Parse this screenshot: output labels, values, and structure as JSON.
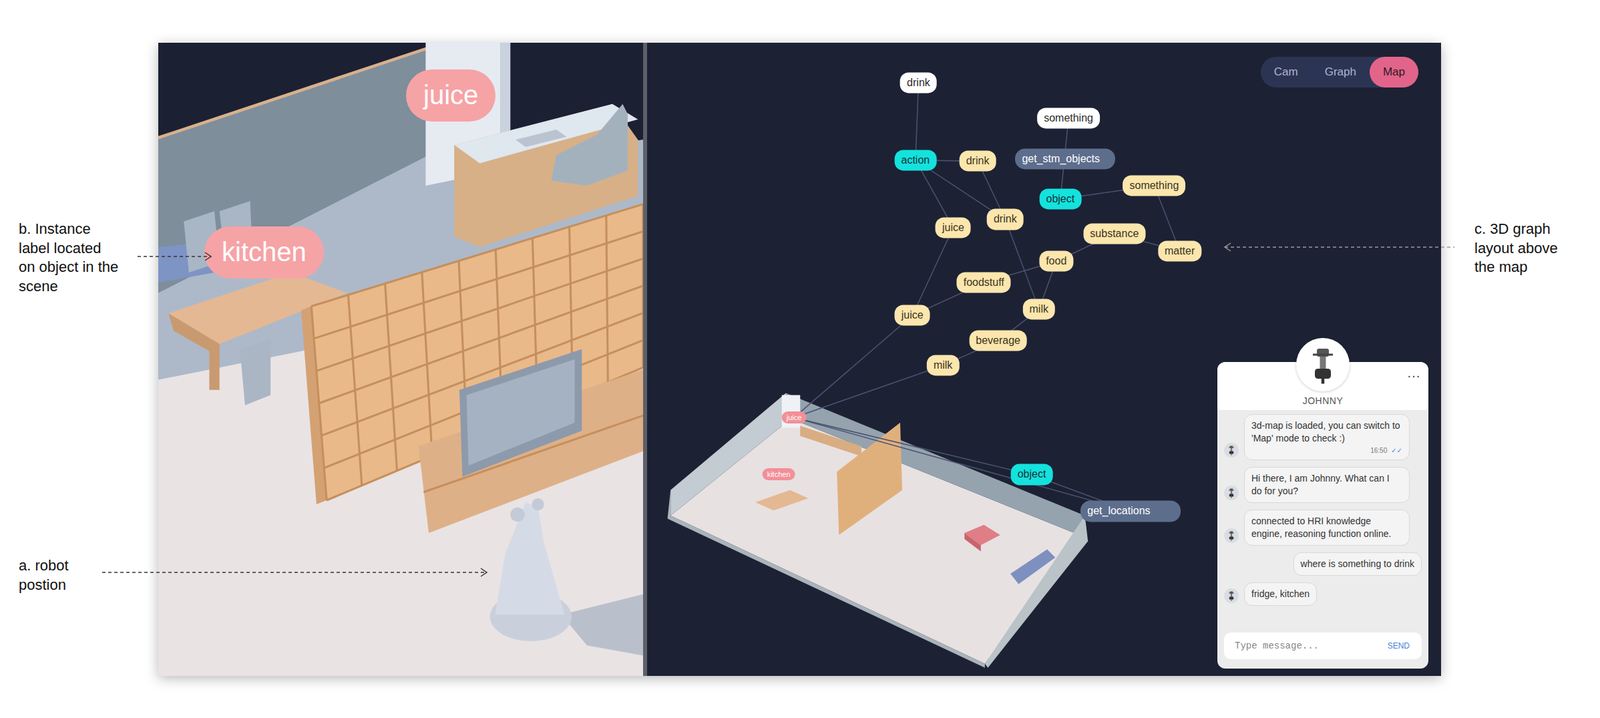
{
  "annotations": [
    {
      "text": "b. Instance label located on object in the scene"
    },
    {
      "text": "a. robot postion"
    },
    {
      "text": "c. 3D graph layout above the map"
    }
  ],
  "scene": {
    "labels": [
      {
        "text": "kitchen"
      },
      {
        "text": "juice"
      }
    ]
  },
  "view_tabs": [
    {
      "label": "Cam",
      "selected": false
    },
    {
      "label": "Graph",
      "selected": false
    },
    {
      "label": "Map",
      "selected": true
    }
  ],
  "graph": {
    "nodes": [
      {
        "label": "drink",
        "kind": "query"
      },
      {
        "label": "something",
        "kind": "query"
      },
      {
        "label": "action",
        "kind": "category"
      },
      {
        "label": "drink",
        "kind": "concept"
      },
      {
        "label": "get_stm_objects",
        "kind": "function"
      },
      {
        "label": "object",
        "kind": "category"
      },
      {
        "label": "something",
        "kind": "concept"
      },
      {
        "label": "juice",
        "kind": "concept"
      },
      {
        "label": "drink",
        "kind": "concept"
      },
      {
        "label": "substance",
        "kind": "concept"
      },
      {
        "label": "matter",
        "kind": "concept"
      },
      {
        "label": "food",
        "kind": "concept"
      },
      {
        "label": "foodstuff",
        "kind": "concept"
      },
      {
        "label": "milk",
        "kind": "concept"
      },
      {
        "label": "juice",
        "kind": "concept"
      },
      {
        "label": "beverage",
        "kind": "concept"
      },
      {
        "label": "milk",
        "kind": "concept"
      },
      {
        "label": "object",
        "kind": "category"
      },
      {
        "label": "get_locations",
        "kind": "function"
      }
    ],
    "edges": [
      [
        0,
        2
      ],
      [
        1,
        5
      ],
      [
        2,
        3
      ],
      [
        2,
        8
      ],
      [
        2,
        7
      ],
      [
        3,
        8
      ],
      [
        7,
        14
      ],
      [
        5,
        6
      ],
      [
        6,
        10
      ],
      [
        9,
        10
      ],
      [
        9,
        11
      ],
      [
        11,
        12
      ],
      [
        12,
        14
      ],
      [
        8,
        13
      ],
      [
        11,
        13
      ],
      [
        13,
        15
      ],
      [
        15,
        16
      ],
      [
        17,
        18
      ]
    ],
    "map_links": [
      14,
      16,
      17,
      18
    ]
  },
  "map": {
    "labels": [
      {
        "text": "juice"
      },
      {
        "text": "kitchen"
      }
    ]
  },
  "chat": {
    "name": "JOHNNY",
    "menu": "···",
    "messages": [
      {
        "from": "bot",
        "text": "3d-map is loaded, you can switch to 'Map' mode to check :)",
        "time": "16:50",
        "ticks": "✓✓"
      },
      {
        "from": "bot",
        "text": "Hi there, I am Johnny. What can I do for you?"
      },
      {
        "from": "bot",
        "text": "connected to HRI knowledge engine, reasoning function online."
      },
      {
        "from": "user",
        "text": "where is something to drink"
      },
      {
        "from": "bot",
        "text": "fridge, kitchen"
      }
    ],
    "input_placeholder": "Type message...",
    "send": "SEND"
  }
}
